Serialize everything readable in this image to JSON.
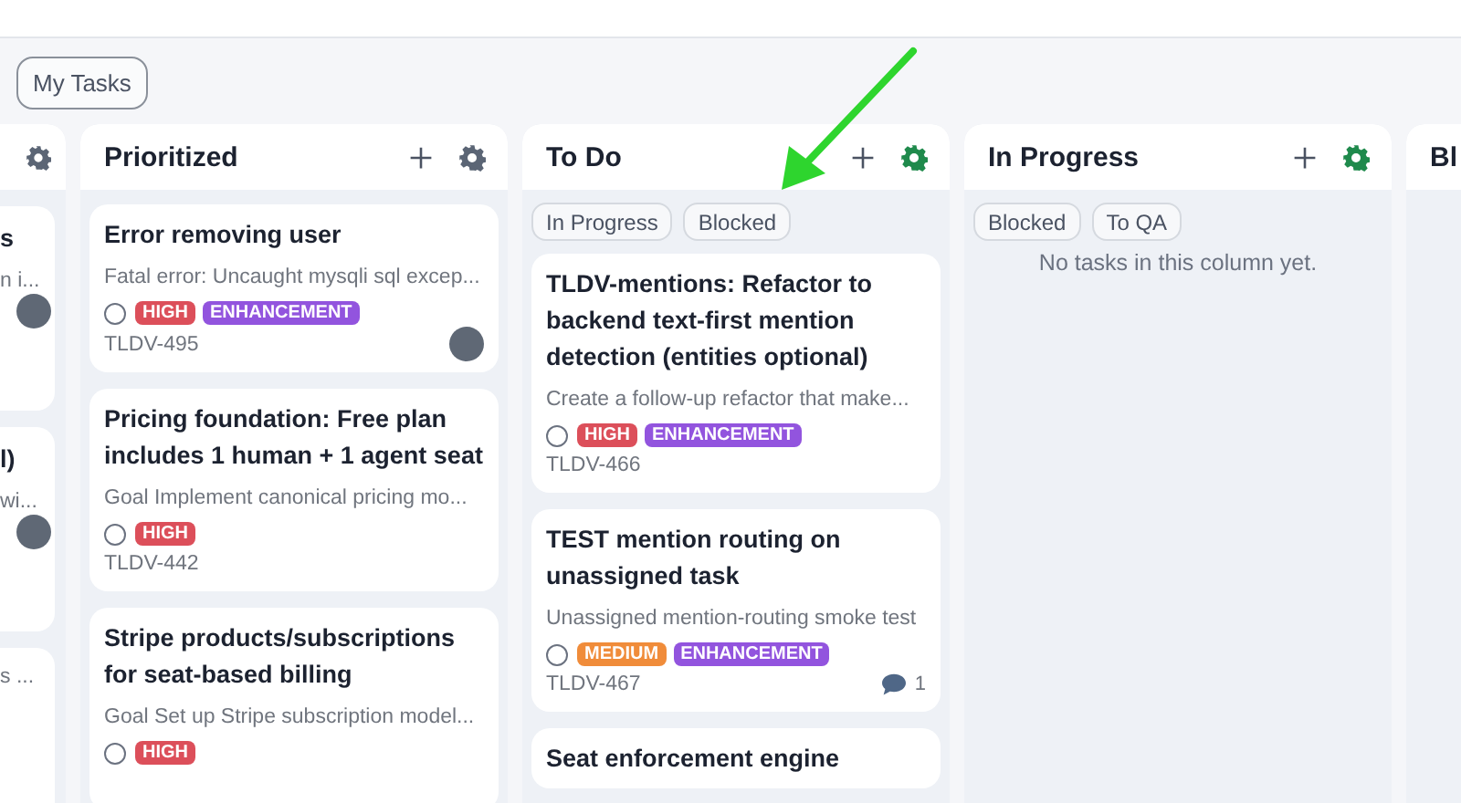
{
  "toolbar": {
    "filter_button": "My Tasks"
  },
  "columns": [
    {
      "kind": "partial",
      "settings_highlighted": false,
      "cards": [
        {
          "title": "s",
          "description": "n i...",
          "avatar": true
        },
        {
          "title": "l)",
          "description": "wi...",
          "avatar": true
        },
        {
          "description": "s ...",
          "avatar": false
        }
      ]
    },
    {
      "kind": "full",
      "title": "Prioritized",
      "settings_highlighted": false,
      "cards": [
        {
          "title": "Error removing user",
          "description": "Fatal error: Uncaught mysqli sql excep...",
          "checked": false,
          "tags": [
            {
              "label": "HIGH",
              "color": "#dc4f5a"
            },
            {
              "label": "ENHANCEMENT",
              "color": "#9254de"
            }
          ],
          "id": "TLDV-495",
          "avatar": true
        },
        {
          "title": "Pricing foundation: Free plan includes 1 human + 1 agent seat",
          "description": "Goal Implement canonical pricing mo...",
          "checked": false,
          "tags": [
            {
              "label": "HIGH",
              "color": "#dc4f5a"
            }
          ],
          "id": "TLDV-442",
          "avatar": false
        },
        {
          "title": "Stripe products/subscriptions for seat-based billing",
          "description": "Goal Set up Stripe subscription model...",
          "checked": false,
          "tags": [
            {
              "label": "HIGH",
              "color": "#dc4f5a"
            }
          ],
          "avatar": false
        }
      ]
    },
    {
      "kind": "full",
      "title": "To Do",
      "settings_highlighted": true,
      "chips": [
        "In Progress",
        "Blocked"
      ],
      "cards": [
        {
          "title": "TLDV-mentions: Refactor to backend text-first mention detection (entities optional)",
          "description": "Create a follow-up refactor that make...",
          "checked": false,
          "tags": [
            {
              "label": "HIGH",
              "color": "#dc4f5a"
            },
            {
              "label": "ENHANCEMENT",
              "color": "#9254de"
            }
          ],
          "id": "TLDV-466",
          "avatar": false
        },
        {
          "title": "TEST mention routing on unassigned task",
          "description": "Unassigned mention-routing smoke test",
          "checked": false,
          "tags": [
            {
              "label": "MEDIUM",
              "color": "#f08c3a"
            },
            {
              "label": "ENHANCEMENT",
              "color": "#9254de"
            }
          ],
          "id": "TLDV-467",
          "avatar": false,
          "comments": "1"
        },
        {
          "title": "Seat enforcement engine"
        }
      ]
    },
    {
      "kind": "full",
      "title": "In Progress",
      "settings_highlighted": true,
      "chips": [
        "Blocked",
        "To QA"
      ],
      "empty_text": "No tasks in this column yet."
    },
    {
      "kind": "partial-right",
      "title": "Bl"
    }
  ]
}
